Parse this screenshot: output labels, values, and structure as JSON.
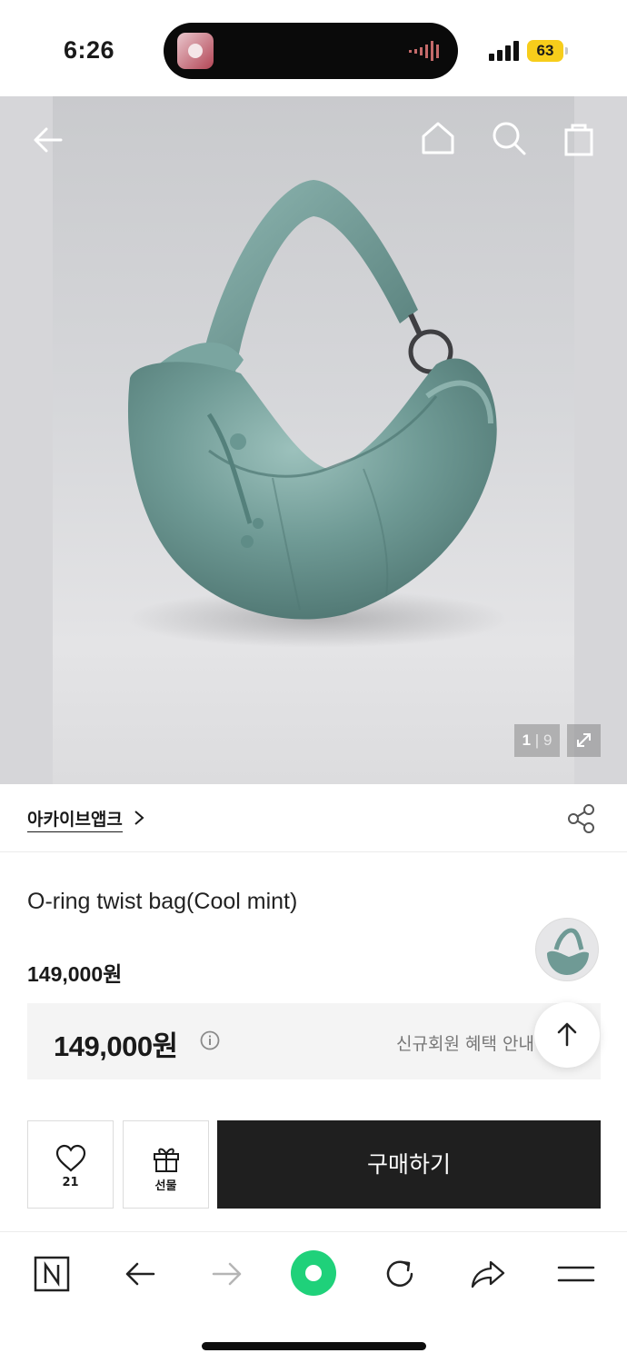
{
  "status_bar": {
    "time": "6:26",
    "battery": "63"
  },
  "gallery": {
    "current": "1",
    "separator": "|",
    "total": "9",
    "bag_color": "#6f9a95"
  },
  "store": {
    "name": "아카이브앱크"
  },
  "product": {
    "title": "O-ring twist bag(Cool mint)",
    "price": "149,000원",
    "final_price": "149,000원",
    "benefit_text": "신규회원 혜택 안내"
  },
  "actions": {
    "wish_count": "21",
    "gift_label": "선물",
    "buy_label": "구매하기"
  },
  "colors": {
    "accent_green": "#1fd17a",
    "buy_bg": "#1f1f1f",
    "battery": "#f7cd1b"
  },
  "toolbar_icons": [
    "naver-n-icon",
    "back-arrow-icon",
    "forward-arrow-icon",
    "green-dot-icon",
    "refresh-icon",
    "share-arrow-icon",
    "menu-icon"
  ]
}
